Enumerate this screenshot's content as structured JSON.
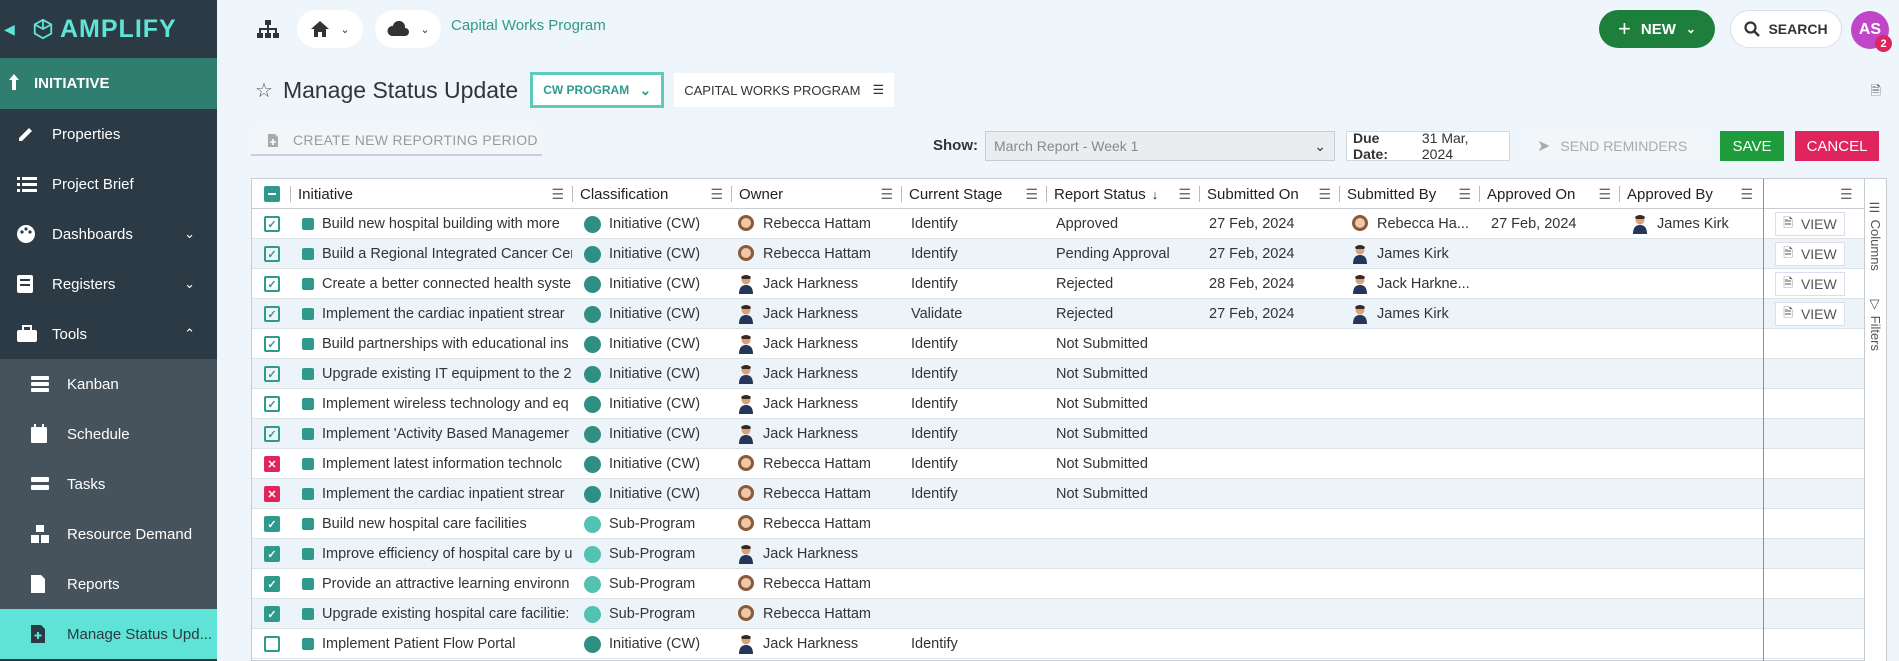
{
  "sidebar": {
    "logo": "AMPLIFY",
    "section": "INITIATIVE",
    "items": [
      {
        "label": "Properties",
        "icon": "pencil-icon",
        "chevron": ""
      },
      {
        "label": "Project Brief",
        "icon": "list-icon",
        "chevron": ""
      },
      {
        "label": "Dashboards",
        "icon": "palette-icon",
        "chevron": "down"
      },
      {
        "label": "Registers",
        "icon": "register-icon",
        "chevron": "down"
      },
      {
        "label": "Tools",
        "icon": "toolbox-icon",
        "chevron": "up"
      }
    ],
    "subitems": [
      {
        "label": "Kanban",
        "icon": "kanban-icon",
        "active": false
      },
      {
        "label": "Schedule",
        "icon": "calendar-icon",
        "active": false
      },
      {
        "label": "Tasks",
        "icon": "tasks-icon",
        "active": false
      },
      {
        "label": "Resource Demand",
        "icon": "resource-icon",
        "active": false
      },
      {
        "label": "Reports",
        "icon": "report-icon",
        "active": false
      },
      {
        "label": "Manage Status Upd...",
        "icon": "status-update-icon",
        "active": true
      }
    ]
  },
  "topbar": {
    "breadcrumb": "Capital Works Program",
    "new_label": "NEW",
    "search_label": "SEARCH",
    "avatar_initials": "AS",
    "avatar_badge": "2"
  },
  "page": {
    "title": "Manage Status Update",
    "program_select": "CW PROGRAM",
    "program_label": "CAPITAL WORKS PROGRAM",
    "create_period": "CREATE NEW REPORTING PERIOD",
    "show_label": "Show:",
    "show_value": "March Report - Week 1",
    "due_date_label": "Due Date:",
    "due_date_value": "31 Mar, 2024",
    "send_reminders": "SEND REMINDERS",
    "save": "SAVE",
    "cancel": "CANCEL"
  },
  "grid": {
    "columns": [
      "Initiative",
      "Classification",
      "Owner",
      "Current Stage",
      "Report Status",
      "Submitted On",
      "Submitted By",
      "Approved On",
      "Approved By"
    ],
    "side_tabs": [
      "Columns",
      "Filters"
    ],
    "view_label": "VIEW",
    "rows": [
      {
        "check": "outline",
        "initiative": "Build new hospital building with more",
        "classification": "Initiative (CW)",
        "cls": "dark",
        "owner": "Rebecca Hattam",
        "owner_g": "f",
        "stage": "Identify",
        "status": "Approved",
        "submitted_on": "27 Feb, 2024",
        "submitted_by": "Rebecca Ha...",
        "sub_g": "f",
        "approved_on": "27 Feb, 2024",
        "approved_by": "James Kirk",
        "view": true
      },
      {
        "check": "outline",
        "initiative": "Build a Regional Integrated Cancer Cer",
        "classification": "Initiative (CW)",
        "cls": "dark",
        "owner": "Rebecca Hattam",
        "owner_g": "f",
        "stage": "Identify",
        "status": "Pending Approval",
        "submitted_on": "27 Feb, 2024",
        "submitted_by": "James Kirk",
        "sub_g": "m",
        "approved_on": "",
        "approved_by": "",
        "view": true
      },
      {
        "check": "outline",
        "initiative": "Create a better connected health syste",
        "classification": "Initiative (CW)",
        "cls": "dark",
        "owner": "Jack Harkness",
        "owner_g": "m",
        "stage": "Identify",
        "status": "Rejected",
        "submitted_on": "28 Feb, 2024",
        "submitted_by": "Jack Harkne...",
        "sub_g": "m",
        "approved_on": "",
        "approved_by": "",
        "view": true
      },
      {
        "check": "outline",
        "initiative": "Implement the cardiac inpatient strear",
        "classification": "Initiative (CW)",
        "cls": "dark",
        "owner": "Jack Harkness",
        "owner_g": "m",
        "stage": "Validate",
        "status": "Rejected",
        "submitted_on": "27 Feb, 2024",
        "submitted_by": "James Kirk",
        "sub_g": "m",
        "approved_on": "",
        "approved_by": "",
        "view": true
      },
      {
        "check": "outline",
        "initiative": "Build partnerships with educational ins",
        "classification": "Initiative (CW)",
        "cls": "dark",
        "owner": "Jack Harkness",
        "owner_g": "m",
        "stage": "Identify",
        "status": "Not Submitted",
        "submitted_on": "",
        "submitted_by": "",
        "sub_g": "",
        "approved_on": "",
        "approved_by": "",
        "view": false
      },
      {
        "check": "outline",
        "initiative": "Upgrade existing IT equipment to the 2",
        "classification": "Initiative (CW)",
        "cls": "dark",
        "owner": "Jack Harkness",
        "owner_g": "m",
        "stage": "Identify",
        "status": "Not Submitted",
        "submitted_on": "",
        "submitted_by": "",
        "sub_g": "",
        "approved_on": "",
        "approved_by": "",
        "view": false
      },
      {
        "check": "outline",
        "initiative": "Implement wireless technology and eq",
        "classification": "Initiative (CW)",
        "cls": "dark",
        "owner": "Jack Harkness",
        "owner_g": "m",
        "stage": "Identify",
        "status": "Not Submitted",
        "submitted_on": "",
        "submitted_by": "",
        "sub_g": "",
        "approved_on": "",
        "approved_by": "",
        "view": false
      },
      {
        "check": "outline",
        "initiative": "Implement 'Activity Based Managemer",
        "classification": "Initiative (CW)",
        "cls": "dark",
        "owner": "Jack Harkness",
        "owner_g": "m",
        "stage": "Identify",
        "status": "Not Submitted",
        "submitted_on": "",
        "submitted_by": "",
        "sub_g": "",
        "approved_on": "",
        "approved_by": "",
        "view": false
      },
      {
        "check": "red",
        "initiative": "Implement latest information technolc",
        "classification": "Initiative (CW)",
        "cls": "dark",
        "owner": "Rebecca Hattam",
        "owner_g": "f",
        "stage": "Identify",
        "status": "Not Submitted",
        "submitted_on": "",
        "submitted_by": "",
        "sub_g": "",
        "approved_on": "",
        "approved_by": "",
        "view": false
      },
      {
        "check": "red",
        "initiative": "Implement the cardiac inpatient strear",
        "classification": "Initiative (CW)",
        "cls": "dark",
        "owner": "Rebecca Hattam",
        "owner_g": "f",
        "stage": "Identify",
        "status": "Not Submitted",
        "submitted_on": "",
        "submitted_by": "",
        "sub_g": "",
        "approved_on": "",
        "approved_by": "",
        "view": false
      },
      {
        "check": "filled",
        "initiative": "Build new hospital care facilities",
        "classification": "Sub-Program",
        "cls": "light",
        "owner": "Rebecca Hattam",
        "owner_g": "f",
        "stage": "",
        "status": "",
        "submitted_on": "",
        "submitted_by": "",
        "sub_g": "",
        "approved_on": "",
        "approved_by": "",
        "view": false
      },
      {
        "check": "filled",
        "initiative": "Improve efficiency of hospital care by u",
        "classification": "Sub-Program",
        "cls": "light",
        "owner": "Jack Harkness",
        "owner_g": "m",
        "stage": "",
        "status": "",
        "submitted_on": "",
        "submitted_by": "",
        "sub_g": "",
        "approved_on": "",
        "approved_by": "",
        "view": false
      },
      {
        "check": "filled",
        "initiative": "Provide an attractive learning environn",
        "classification": "Sub-Program",
        "cls": "light",
        "owner": "Rebecca Hattam",
        "owner_g": "f",
        "stage": "",
        "status": "",
        "submitted_on": "",
        "submitted_by": "",
        "sub_g": "",
        "approved_on": "",
        "approved_by": "",
        "view": false
      },
      {
        "check": "filled",
        "initiative": "Upgrade existing hospital care facilitie:",
        "classification": "Sub-Program",
        "cls": "light",
        "owner": "Rebecca Hattam",
        "owner_g": "f",
        "stage": "",
        "status": "",
        "submitted_on": "",
        "submitted_by": "",
        "sub_g": "",
        "approved_on": "",
        "approved_by": "",
        "view": false
      },
      {
        "check": "empty",
        "initiative": "Implement Patient Flow Portal",
        "classification": "Initiative (CW)",
        "cls": "dark",
        "owner": "Jack Harkness",
        "owner_g": "m",
        "stage": "Identify",
        "status": "",
        "submitted_on": "",
        "submitted_by": "",
        "sub_g": "",
        "approved_on": "",
        "approved_by": "",
        "view": false
      }
    ]
  }
}
